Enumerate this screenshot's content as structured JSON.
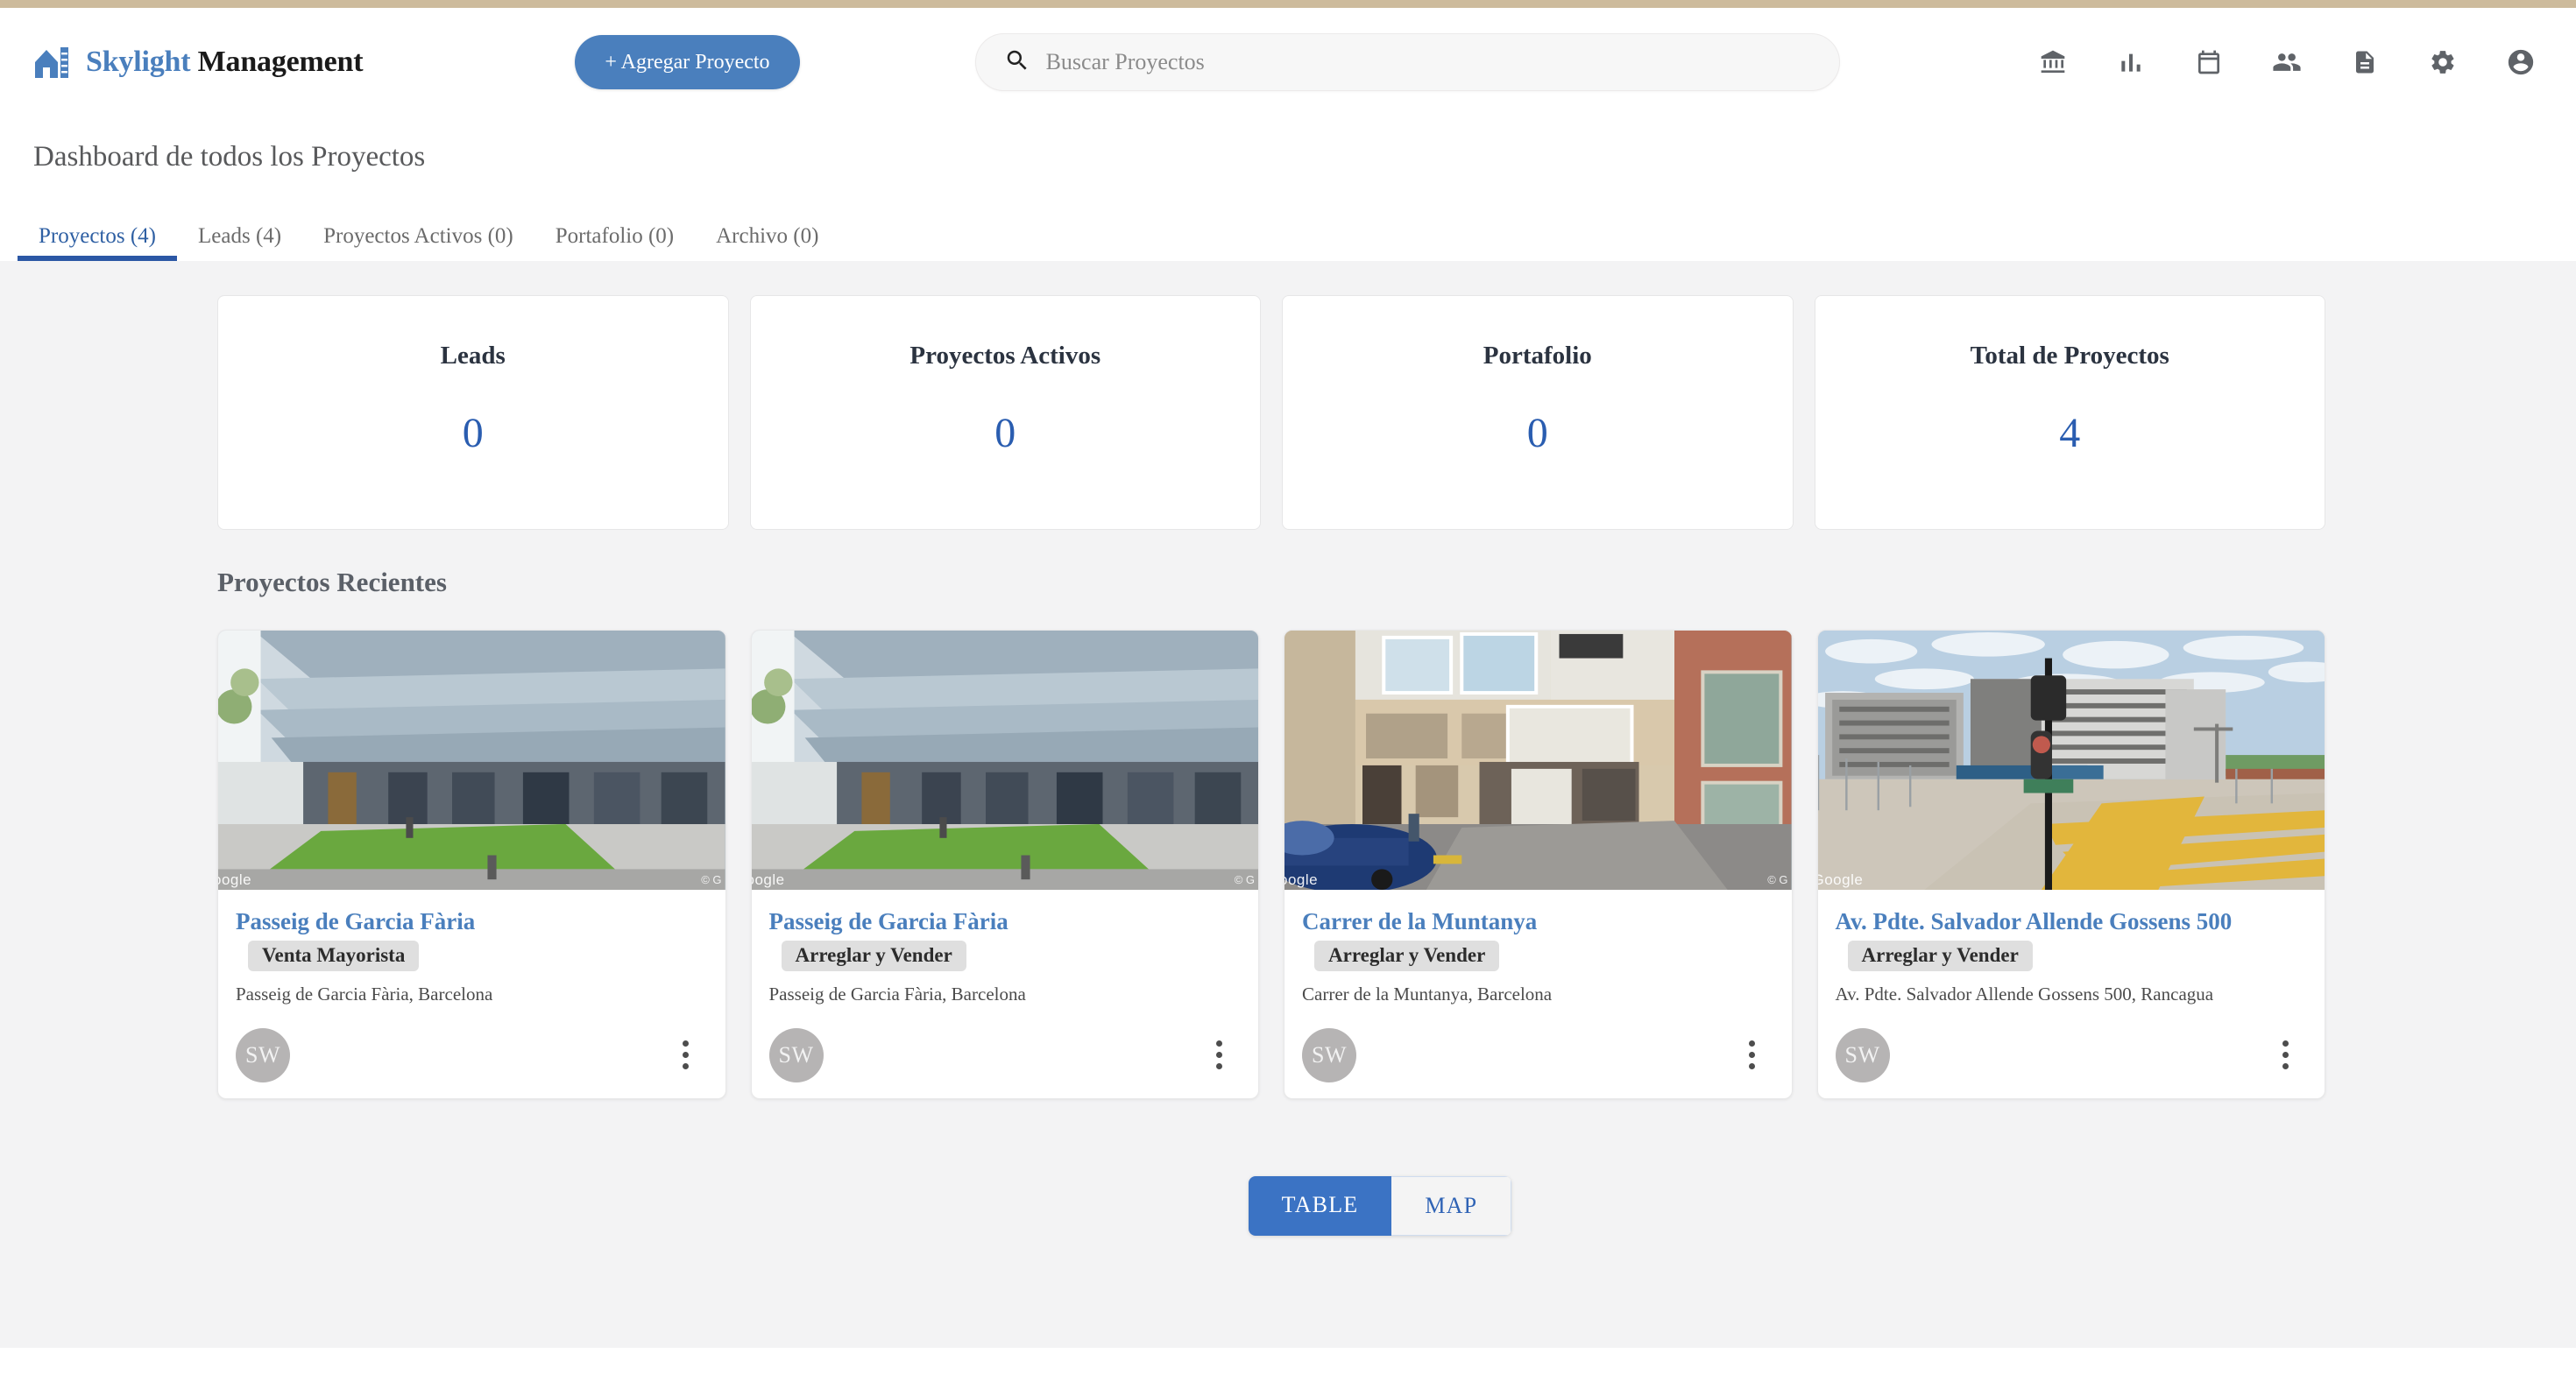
{
  "brand": {
    "name_primary": "Skylight",
    "name_secondary": "Management",
    "logo_icon": "house-building-icon"
  },
  "header": {
    "add_project_button": "+ Agregar Proyecto",
    "search": {
      "placeholder": "Buscar Proyectos",
      "value": "",
      "icon": "search-icon"
    },
    "icons": [
      {
        "name": "bank-icon",
        "label": "Bancos"
      },
      {
        "name": "bar-chart-icon",
        "label": "Reportes"
      },
      {
        "name": "calendar-icon",
        "label": "Calendario"
      },
      {
        "name": "people-icon",
        "label": "Contactos"
      },
      {
        "name": "document-icon",
        "label": "Documentos"
      },
      {
        "name": "gear-icon",
        "label": "Configuracion"
      },
      {
        "name": "account-circle-icon",
        "label": "Cuenta"
      }
    ]
  },
  "page": {
    "title": "Dashboard de todos los Proyectos",
    "section_recent_title": "Proyectos Recientes"
  },
  "tabs": [
    {
      "label": "Proyectos (4)",
      "active": true
    },
    {
      "label": "Leads (4)",
      "active": false
    },
    {
      "label": "Proyectos Activos (0)",
      "active": false
    },
    {
      "label": "Portafolio (0)",
      "active": false
    },
    {
      "label": "Archivo (0)",
      "active": false
    }
  ],
  "stats": [
    {
      "title": "Leads",
      "value": "0"
    },
    {
      "title": "Proyectos Activos",
      "value": "0"
    },
    {
      "title": "Portafolio",
      "value": "0"
    },
    {
      "title": "Total de Proyectos",
      "value": "4"
    }
  ],
  "projects": [
    {
      "name": "Passeig de Garcia Fària",
      "badge": "Venta Mayorista",
      "address": "Passeig de Garcia Fària, Barcelona",
      "avatar_initials": "SW",
      "image_watermark": "oogle",
      "image_attribution": "© G",
      "image_scene": "glass-office-building-with-lawn"
    },
    {
      "name": "Passeig de Garcia Fària",
      "badge": "Arreglar y Vender",
      "address": "Passeig de Garcia Fària, Barcelona",
      "avatar_initials": "SW",
      "image_watermark": "oogle",
      "image_attribution": "© G",
      "image_scene": "glass-office-building-with-lawn"
    },
    {
      "name": "Carrer de la Muntanya",
      "badge": "Arreglar y Vender",
      "address": "Carrer de la Muntanya, Barcelona",
      "avatar_initials": "SW",
      "image_watermark": "oogle",
      "image_attribution": "© G",
      "image_scene": "street-with-blue-car-and-garage"
    },
    {
      "name": "Av. Pdte. Salvador Allende Gossens 500",
      "badge": "Arreglar y Vender",
      "address": "Av. Pdte. Salvador Allende Gossens 500, Rancagua",
      "avatar_initials": "SW",
      "image_watermark": "Google",
      "image_attribution": "",
      "image_scene": "apartment-blocks-with-construction-fence"
    }
  ],
  "view_toggle": {
    "options": [
      "TABLE",
      "MAP"
    ],
    "selected": "TABLE"
  },
  "colors": {
    "accent_blue": "#4a7fbd",
    "tab_active_blue": "#2b57a5",
    "stat_value_blue": "#2a5db0",
    "top_strip": "#cdbb9c",
    "page_bg": "#f3f3f4",
    "badge_bg": "#dfdfdf",
    "avatar_bg": "#b6b4b4"
  }
}
